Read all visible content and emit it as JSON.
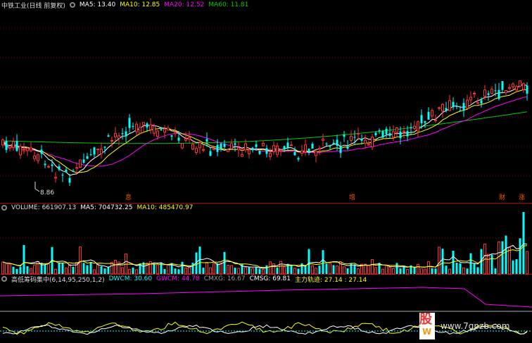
{
  "price_panel": {
    "title": "中铁工业(日线 前复权)",
    "ma_legend": [
      {
        "label": "MA5: 13.40",
        "color": "#ffffff"
      },
      {
        "label": "MA10: 12.85",
        "color": "#ffff00"
      },
      {
        "label": "MA20: 12.52",
        "color": "#ff00ff"
      },
      {
        "label": "MA60: 11.81",
        "color": "#00cc00"
      }
    ],
    "low_marker": "8.86",
    "event_markers": [
      "息",
      "增",
      "财",
      "涨"
    ]
  },
  "volume_panel": {
    "title": "VOLUME: 661907.13",
    "ma_legend": [
      {
        "label": "MA5: 704732.25",
        "color": "#ffffff"
      },
      {
        "label": "MA10: 485470.97",
        "color": "#ffff00"
      }
    ]
  },
  "chip_panel": {
    "title": "高低筹码集中(6,14,95,250,1,2)",
    "legend": [
      {
        "label": "DWCM: 30.60",
        "color": "#00ffff"
      },
      {
        "label": "GWCM: 44.78",
        "color": "#ff00ff"
      },
      {
        "label": "CMXG: 16.67",
        "color": "#999999"
      },
      {
        "label": "CMSG: 69.81",
        "color": "#ffffff"
      },
      {
        "label": "主力轨迹: 27.14 : 27.14",
        "color": "#ffff00"
      }
    ]
  },
  "watermark": {
    "logo_char": "股",
    "logo_sub": "W",
    "url": "www.7gpzb.com"
  },
  "colors": {
    "up": "#ff3333",
    "down": "#00ffff",
    "ma5": "#ffffff",
    "ma10": "#ffff00",
    "ma20": "#ff00ff",
    "ma60": "#00cc00",
    "grid": "#8b0000"
  }
}
